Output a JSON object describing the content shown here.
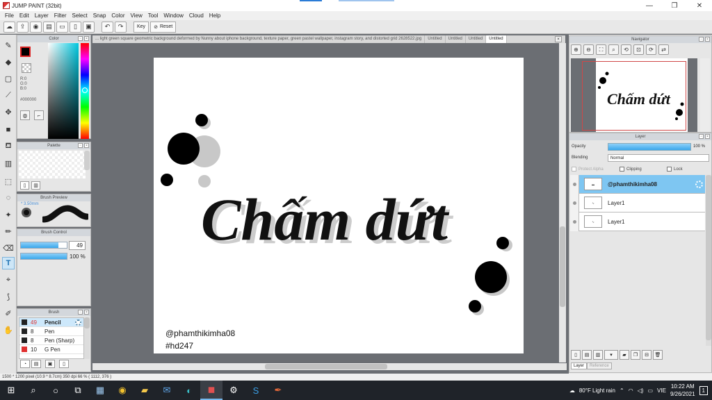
{
  "window": {
    "title": "JUMP PAINT (32bit)",
    "minimize": "—",
    "maximize": "❐",
    "close": "✕"
  },
  "menu": [
    "File",
    "Edit",
    "Layer",
    "Filter",
    "Select",
    "Snap",
    "Color",
    "View",
    "Tool",
    "Window",
    "Cloud",
    "Help"
  ],
  "toolbar": {
    "key_label": "Key",
    "reset_label": "Reset"
  },
  "color_panel": {
    "title": "Color",
    "r": "R:0",
    "g": "G:0",
    "b": "B:0",
    "hex": "#000000",
    "current_color": "#000000"
  },
  "palette_panel": {
    "title": "Palette"
  },
  "brush_preview": {
    "title": "Brush Preview",
    "size_label": "* 3.50mm"
  },
  "brush_control": {
    "title": "Brush Control",
    "size_value": "49",
    "size_fraction": 0.82,
    "opacity_label": "100 %",
    "opacity_fraction": 1.0
  },
  "brush_panel": {
    "title": "Brush",
    "items": [
      {
        "size": "49",
        "name": "Pencil",
        "color": "#222222",
        "selected": true
      },
      {
        "size": "8",
        "name": "Pen",
        "color": "#222222"
      },
      {
        "size": "8",
        "name": "Pen (Sharp)",
        "color": "#222222"
      },
      {
        "size": "10",
        "name": "G Pen",
        "color": "#e03030"
      }
    ]
  },
  "tabs": [
    "... light green square geometric background deformed by Nunny about iphone background, texture paper, green pastel wallpaper, instagram story, and distorted grid 2628522.jpg",
    "Untitled",
    "Untitled",
    "Untitled",
    "Untitled"
  ],
  "canvas": {
    "lettering": "Chấm dứt",
    "signature_handle": "@phamthikimha08",
    "signature_tag": "#hd247"
  },
  "navigator": {
    "title": "Navigator"
  },
  "layer_panel": {
    "title": "Layer",
    "opacity_label": "Opacity",
    "opacity_value": "100 %",
    "blending_label": "Blending",
    "blending_value": "Normal",
    "protect_alpha": "Protect Alpha",
    "clipping": "Clipping",
    "lock": "Lock",
    "layers": [
      {
        "name": "@phamthikimha08",
        "selected": true
      },
      {
        "name": "Layer1"
      },
      {
        "name": "Layer1"
      }
    ],
    "tab_layer": "Layer",
    "tab_reference": "Reference"
  },
  "status": {
    "text": "1500 * 1200 pixel   (10.9 * 8.7cm)   350 dpi   66 %   ( 1112, 376 )"
  },
  "taskbar": {
    "weather": "80°F  Light rain",
    "language": "VIE",
    "time": "10:22 AM",
    "date": "9/26/2021",
    "notification_count": "1"
  }
}
